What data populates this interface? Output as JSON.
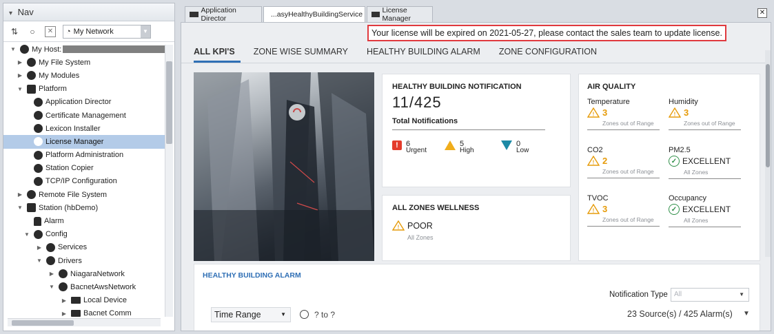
{
  "nav": {
    "title": "Nav",
    "network_select": "My Network",
    "tree": [
      {
        "label": "My Host:",
        "level": 0,
        "arrow": "down",
        "icon": "host-icon"
      },
      {
        "label": "My File System",
        "level": 1,
        "arrow": "right",
        "icon": "drive-icon"
      },
      {
        "label": "My Modules",
        "level": 1,
        "arrow": "right",
        "icon": "modules-icon"
      },
      {
        "label": "Platform",
        "level": 1,
        "arrow": "down",
        "icon": "platform-icon"
      },
      {
        "label": "Application Director",
        "level": 2,
        "arrow": "",
        "icon": "app-director-icon"
      },
      {
        "label": "Certificate Management",
        "level": 2,
        "arrow": "",
        "icon": "certificate-icon"
      },
      {
        "label": "Lexicon Installer",
        "level": 2,
        "arrow": "",
        "icon": "lexicon-icon"
      },
      {
        "label": "License Manager",
        "level": 2,
        "arrow": "",
        "icon": "license-icon",
        "selected": true
      },
      {
        "label": "Platform Administration",
        "level": 2,
        "arrow": "",
        "icon": "admin-icon"
      },
      {
        "label": "Station Copier",
        "level": 2,
        "arrow": "",
        "icon": "copier-icon"
      },
      {
        "label": "TCP/IP Configuration",
        "level": 2,
        "arrow": "",
        "icon": "tcpip-icon"
      },
      {
        "label": "Remote File System",
        "level": 1,
        "arrow": "right",
        "icon": "remote-fs-icon"
      },
      {
        "label": "Station (hbDemo)",
        "level": 1,
        "arrow": "down",
        "icon": "station-icon"
      },
      {
        "label": "Alarm",
        "level": 2,
        "arrow": "",
        "icon": "bell-icon"
      },
      {
        "label": "Config",
        "level": 2,
        "arrow": "down",
        "icon": "config-icon"
      },
      {
        "label": "Services",
        "level": 3,
        "arrow": "right",
        "icon": "services-icon"
      },
      {
        "label": "Drivers",
        "level": 3,
        "arrow": "down",
        "icon": "drivers-icon"
      },
      {
        "label": "NiagaraNetwork",
        "level": 4,
        "arrow": "right",
        "icon": "network-icon"
      },
      {
        "label": "BacnetAwsNetwork",
        "level": 4,
        "arrow": "down",
        "icon": "network-icon"
      },
      {
        "label": "Local Device",
        "level": 5,
        "arrow": "right",
        "icon": "folder-icon"
      },
      {
        "label": "Bacnet Comm",
        "level": 5,
        "arrow": "right",
        "icon": "folder-icon"
      }
    ]
  },
  "tabs": [
    {
      "label": "Application Director"
    },
    {
      "label": "...asyHealthyBuildingService"
    },
    {
      "label": "License Manager"
    }
  ],
  "banner": "Your license will be expired on 2021-05-27, please contact the sales team to update license.",
  "subtabs": [
    "ALL KPI'S",
    "ZONE WISE SUMMARY",
    "HEALTHY BUILDING ALARM",
    "ZONE CONFIGURATION"
  ],
  "notification": {
    "title": "HEALTHY BUILDING NOTIFICATION",
    "count": "11/425",
    "total_label": "Total Notifications",
    "urgent": {
      "value": "6",
      "label": "Urgent"
    },
    "high": {
      "value": "5",
      "label": "High"
    },
    "low": {
      "value": "0",
      "label": "Low"
    }
  },
  "wellness": {
    "title": "ALL ZONES WELLNESS",
    "status": "POOR",
    "sub": "All Zones"
  },
  "air_quality": {
    "title": "AIR QUALITY",
    "metrics": [
      {
        "name": "Temperature",
        "value": "3",
        "sub": "Zones out of Range",
        "status": "warn"
      },
      {
        "name": "Humidity",
        "value": "3",
        "sub": "Zones out of Range",
        "status": "warn"
      },
      {
        "name": "CO2",
        "value": "2",
        "sub": "Zones out of Range",
        "status": "warn"
      },
      {
        "name": "PM2.5",
        "value": "EXCELLENT",
        "sub": "All Zones",
        "status": "ok"
      },
      {
        "name": "TVOC",
        "value": "3",
        "sub": "Zones out of Range",
        "status": "warn"
      },
      {
        "name": "Occupancy",
        "value": "EXCELLENT",
        "sub": "All Zones",
        "status": "ok"
      }
    ]
  },
  "alarm": {
    "title": "HEALTHY BUILDING ALARM",
    "notification_type_label": "Notification Type",
    "notification_type_value": "All",
    "time_range": "Time Range",
    "range_value": "? to ?",
    "sources": "23 Source(s) / 425 Alarm(s)"
  },
  "colors": {
    "accent": "#2f6fb5",
    "banner_border": "#e0393e",
    "warning": "#f0ad1c",
    "urgent": "#e43b2b",
    "ok": "#2f8f48",
    "selected_row": "#b3cbe8"
  }
}
